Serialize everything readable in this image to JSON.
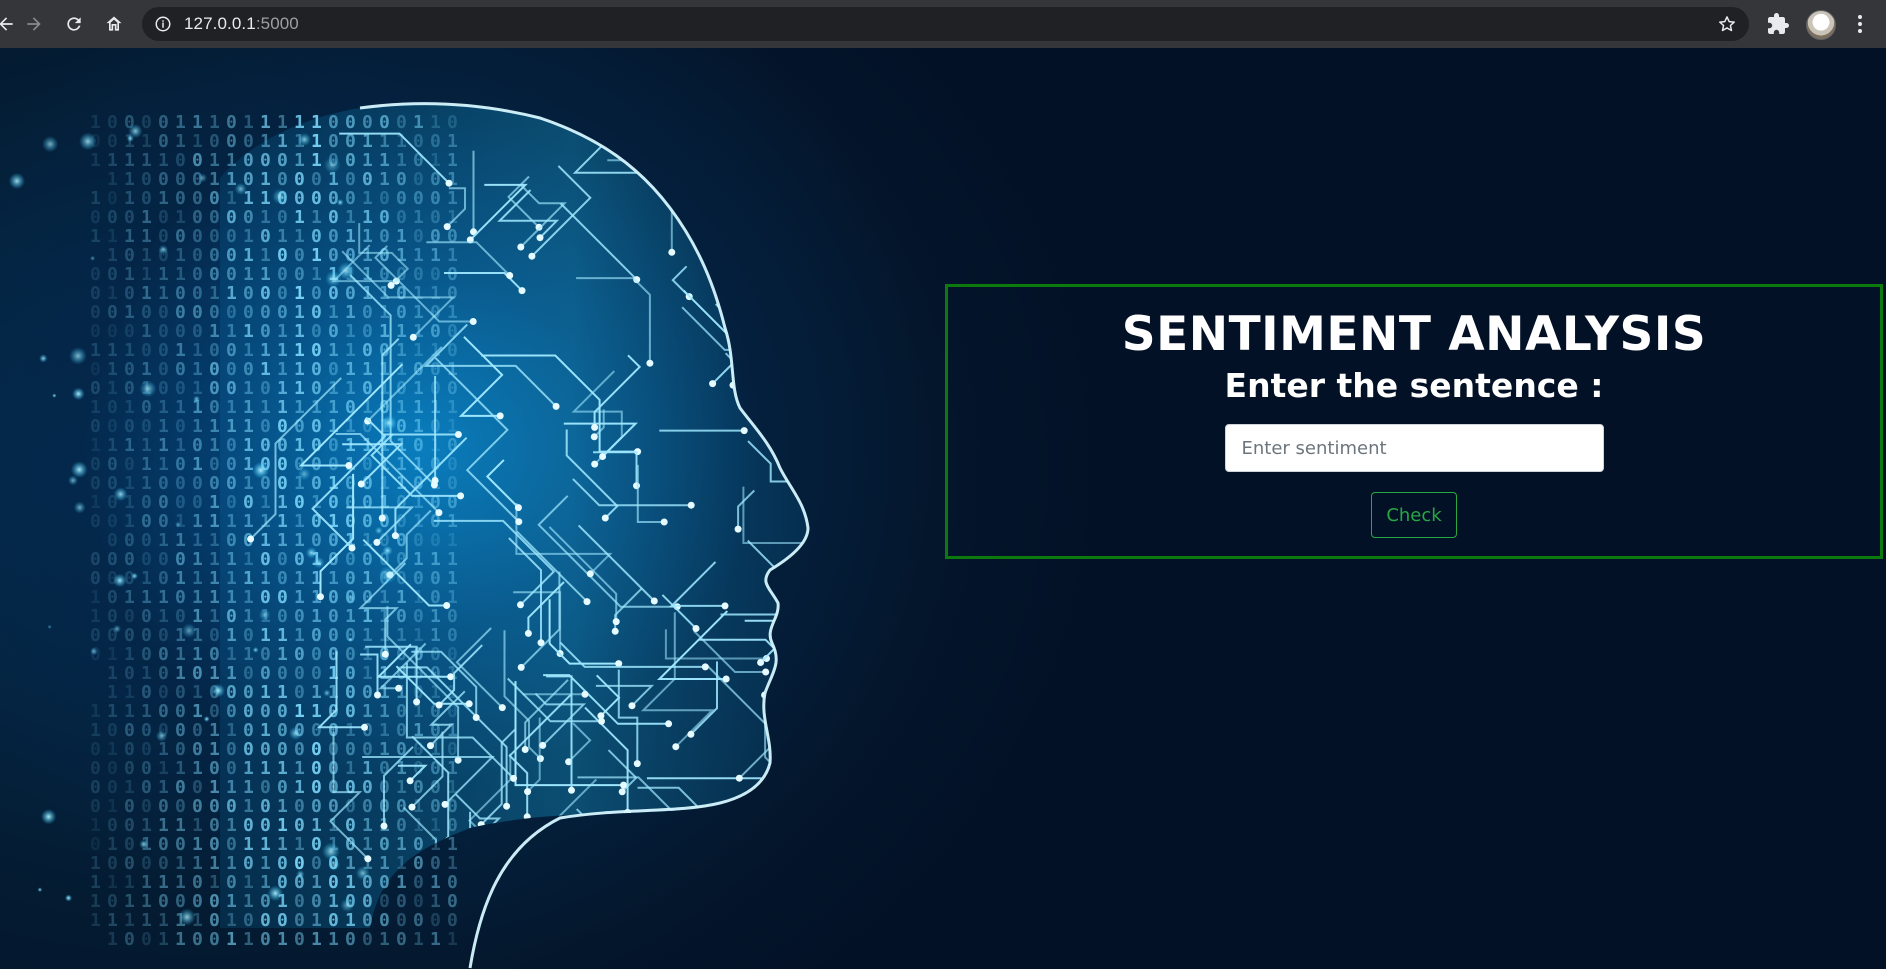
{
  "browser": {
    "url_host": "127.0.0.1",
    "url_port": ":5000"
  },
  "page": {
    "title": "SENTIMENT ANALYSIS",
    "subtitle": "Enter the sentence :",
    "input_placeholder": "Enter sentiment",
    "input_value": "",
    "button_label": "Check"
  },
  "colors": {
    "panel_border": "#0d7a0d",
    "button_accent": "#28a745",
    "background": "#041627",
    "circuit": "#9fe8ff"
  },
  "icons": {
    "back": "back-arrow-icon",
    "forward": "forward-arrow-icon",
    "reload": "reload-icon",
    "home": "home-icon",
    "site_info": "info-icon",
    "bookmark": "star-icon",
    "extensions": "puzzle-icon",
    "profile": "avatar",
    "menu": "kebab-menu-icon"
  }
}
